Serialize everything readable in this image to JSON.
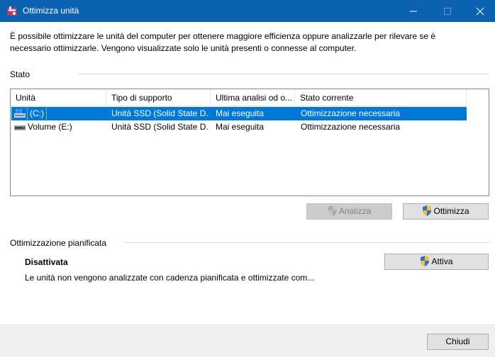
{
  "window": {
    "title": "Ottimizza unità",
    "controls": {
      "minimize": "minimize-icon",
      "maximize": "maximize-icon",
      "close": "close-icon"
    }
  },
  "description": "È possibile ottimizzare le unità del computer per ottenere maggiore efficienza oppure analizzarle per rilevare se è necessario ottimizzarle. Vengono visualizzate solo le unità presenti o connesse al computer.",
  "status": {
    "group_label": "Stato",
    "columns": [
      "Unità",
      "Tipo di supporto",
      "Ultima analisi od o...",
      "Stato corrente"
    ],
    "rows": [
      {
        "drive": "(C:)",
        "media": "Unità SSD (Solid State D...",
        "last": "Mai eseguita",
        "state": "Ottimizzazione necessaria",
        "selected": true,
        "icon": "windows-drive-icon"
      },
      {
        "drive": "Volume (E:)",
        "media": "Unità SSD (Solid State D...",
        "last": "Mai eseguita",
        "state": "Ottimizzazione necessaria",
        "selected": false,
        "icon": "drive-icon"
      }
    ],
    "analyze_label": "Analizza",
    "optimize_label": "Ottimizza"
  },
  "schedule": {
    "group_label": "Ottimizzazione pianificata",
    "status": "Disattivata",
    "description": "Le unità non vengono analizzate con cadenza pianificata e ottimizzate com...",
    "enable_label": "Attiva"
  },
  "footer": {
    "close_label": "Chiudi"
  },
  "colors": {
    "titlebar": "#0b62b0",
    "selection": "#0078d7",
    "footer": "#f0f0f0"
  }
}
